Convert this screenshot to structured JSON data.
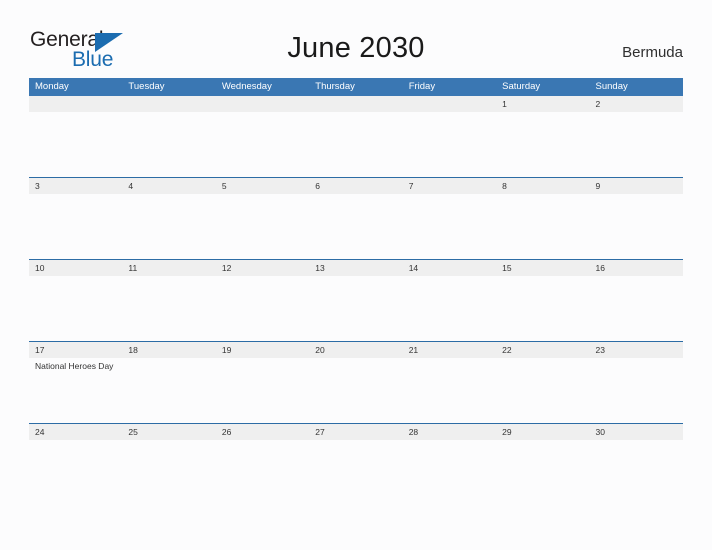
{
  "brand": {
    "name_part1": "General",
    "name_part2": "Blue",
    "accent_color": "#1b6cb0"
  },
  "header": {
    "title": "June 2030",
    "region": "Bermuda"
  },
  "theme": {
    "header_blue": "#3a77b3",
    "separator_blue": "#2c6ca5",
    "daynum_band": "#efefef",
    "page_background": "#fcfcfd"
  },
  "calendar": {
    "weekdays": [
      "Monday",
      "Tuesday",
      "Wednesday",
      "Thursday",
      "Friday",
      "Saturday",
      "Sunday"
    ],
    "weeks": [
      {
        "days": [
          {
            "num": "",
            "event": ""
          },
          {
            "num": "",
            "event": ""
          },
          {
            "num": "",
            "event": ""
          },
          {
            "num": "",
            "event": ""
          },
          {
            "num": "",
            "event": ""
          },
          {
            "num": "1",
            "event": ""
          },
          {
            "num": "2",
            "event": ""
          }
        ]
      },
      {
        "days": [
          {
            "num": "3",
            "event": ""
          },
          {
            "num": "4",
            "event": ""
          },
          {
            "num": "5",
            "event": ""
          },
          {
            "num": "6",
            "event": ""
          },
          {
            "num": "7",
            "event": ""
          },
          {
            "num": "8",
            "event": ""
          },
          {
            "num": "9",
            "event": ""
          }
        ]
      },
      {
        "days": [
          {
            "num": "10",
            "event": ""
          },
          {
            "num": "11",
            "event": ""
          },
          {
            "num": "12",
            "event": ""
          },
          {
            "num": "13",
            "event": ""
          },
          {
            "num": "14",
            "event": ""
          },
          {
            "num": "15",
            "event": ""
          },
          {
            "num": "16",
            "event": ""
          }
        ]
      },
      {
        "days": [
          {
            "num": "17",
            "event": "National Heroes Day"
          },
          {
            "num": "18",
            "event": ""
          },
          {
            "num": "19",
            "event": ""
          },
          {
            "num": "20",
            "event": ""
          },
          {
            "num": "21",
            "event": ""
          },
          {
            "num": "22",
            "event": ""
          },
          {
            "num": "23",
            "event": ""
          }
        ]
      },
      {
        "days": [
          {
            "num": "24",
            "event": ""
          },
          {
            "num": "25",
            "event": ""
          },
          {
            "num": "26",
            "event": ""
          },
          {
            "num": "27",
            "event": ""
          },
          {
            "num": "28",
            "event": ""
          },
          {
            "num": "29",
            "event": ""
          },
          {
            "num": "30",
            "event": ""
          }
        ]
      }
    ]
  }
}
